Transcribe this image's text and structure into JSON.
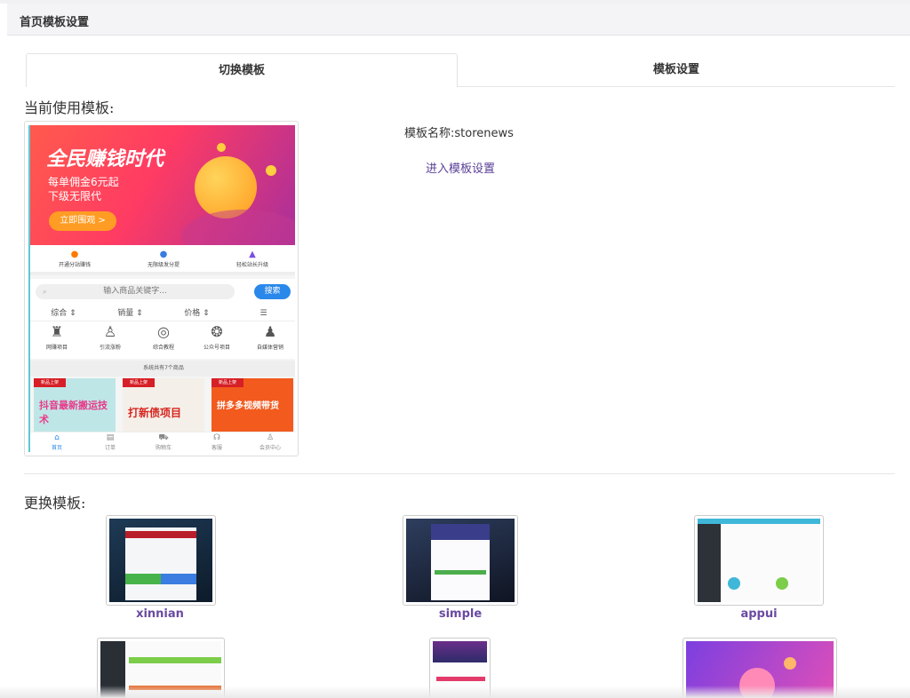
{
  "header": {
    "title": "首页模板设置"
  },
  "tabs": [
    {
      "label": "切换模板",
      "active": true
    },
    {
      "label": "模板设置",
      "active": false
    }
  ],
  "current": {
    "section_title": "当前使用模板:",
    "template_name": "模板名称:storenews",
    "settings_link": "进入模板设置",
    "preview": {
      "banner_main": "全民赚钱时代",
      "banner_sub1": "每单佣金6元起",
      "banner_sub2": "下级无限代",
      "banner_button": "立即围观 >",
      "perks": [
        "开通分站赚钱",
        "无限级发分提",
        "轻松站长升级"
      ],
      "search_placeholder": "输入商品关键字...",
      "search_button": "搜索",
      "sort": [
        "综合 ⇕",
        "销量 ⇕",
        "价格 ⇕",
        "☰"
      ],
      "categories": [
        "网赚项目",
        "引流涨粉",
        "综合教程",
        "公众号项目",
        "自媒体营销"
      ],
      "goods_count": "系统共有7个商品",
      "goods_tag": "新品上架",
      "goods": [
        "抖音最新搬运技术",
        "打新债项目",
        "拼多多视频带货"
      ],
      "bottom_tabs": [
        "首页",
        "订单",
        "购物车",
        "客服",
        "会员中心"
      ]
    }
  },
  "more": {
    "section_title": "更换模板:",
    "templates": [
      {
        "name": "xinnian"
      },
      {
        "name": "simple"
      },
      {
        "name": "appui"
      },
      {
        "name": ""
      },
      {
        "name": ""
      },
      {
        "name": ""
      }
    ]
  },
  "colors": {
    "accent": "#5a3f96",
    "search_blue": "#2a88ea",
    "tag_red": "#d61f26"
  }
}
